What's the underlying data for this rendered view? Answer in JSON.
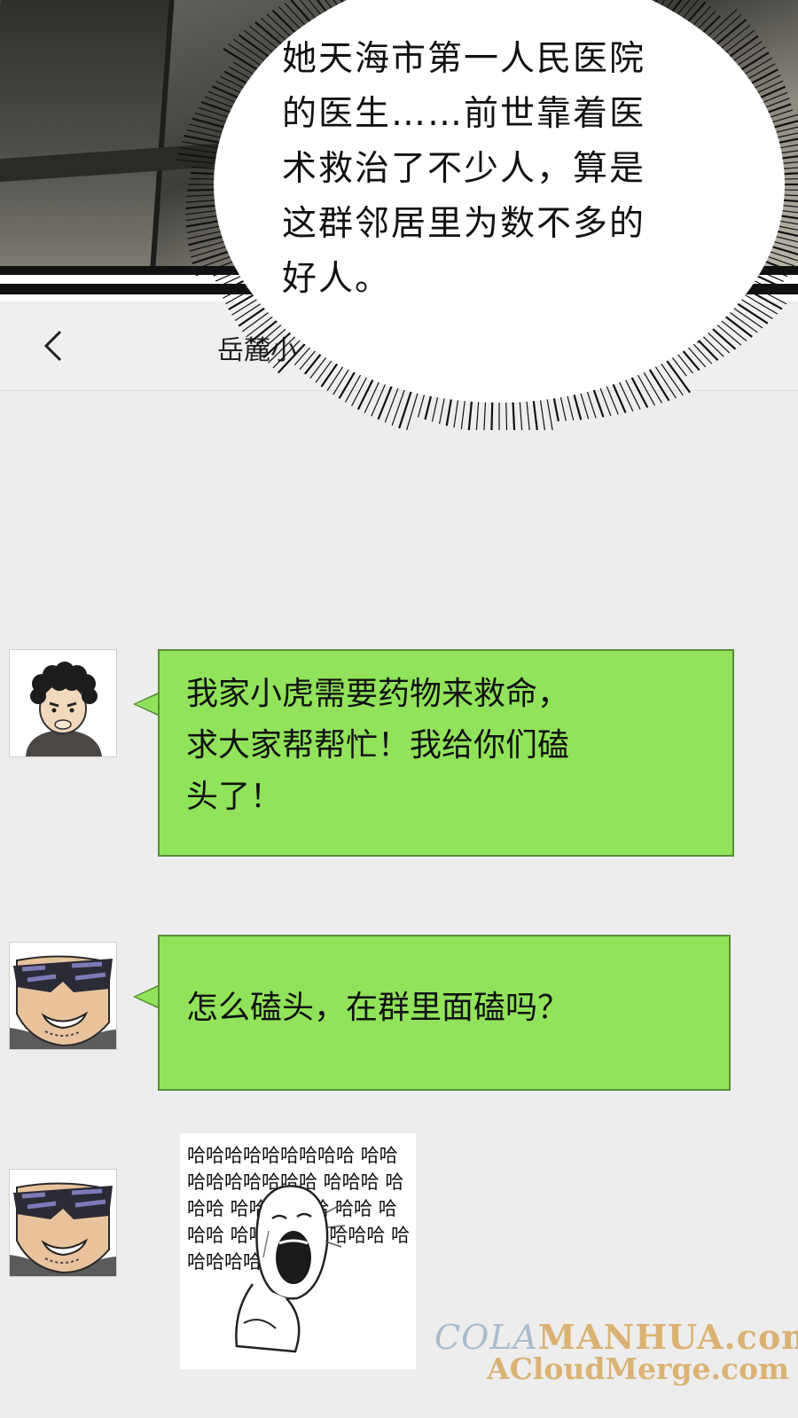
{
  "speech_bubble": {
    "lines": [
      "她天海市第一人民医院",
      "的医生……前世靠着医",
      "术救治了不少人，算是",
      "这群邻居里为数不多的",
      "好人。"
    ]
  },
  "chat_header": {
    "back_icon": "chevron-left-icon",
    "title": "岳麓小",
    "more_icon": "···"
  },
  "messages": [
    {
      "sender_avatar": "curly-hair-man-avatar",
      "lines": [
        "我家小虎需要药物来救命，",
        "求大家帮帮忙！我给你们磕",
        "头了！"
      ]
    },
    {
      "sender_avatar": "sunglasses-man-avatar",
      "lines": [
        "怎么磕头，在群里面磕吗？"
      ]
    },
    {
      "sender_avatar": "sunglasses-man-avatar",
      "sticker_text": "哈哈哈哈哈哈哈哈哈 哈哈哈哈哈哈哈哈哈 哈哈哈 哈哈哈 哈哈 哈哈哈 哈哈 哈哈哈 哈哈哈哈 哈哈哈哈 哈哈哈哈哈哈"
    }
  ],
  "watermark": {
    "line1_prefix": "COLA",
    "line1_rest": "MANHUA.com",
    "line2": "ACloudMerge.com"
  },
  "colors": {
    "chat_background": "#ededed",
    "bubble_green": "#90e35a",
    "bubble_border": "#5a8e3a"
  }
}
